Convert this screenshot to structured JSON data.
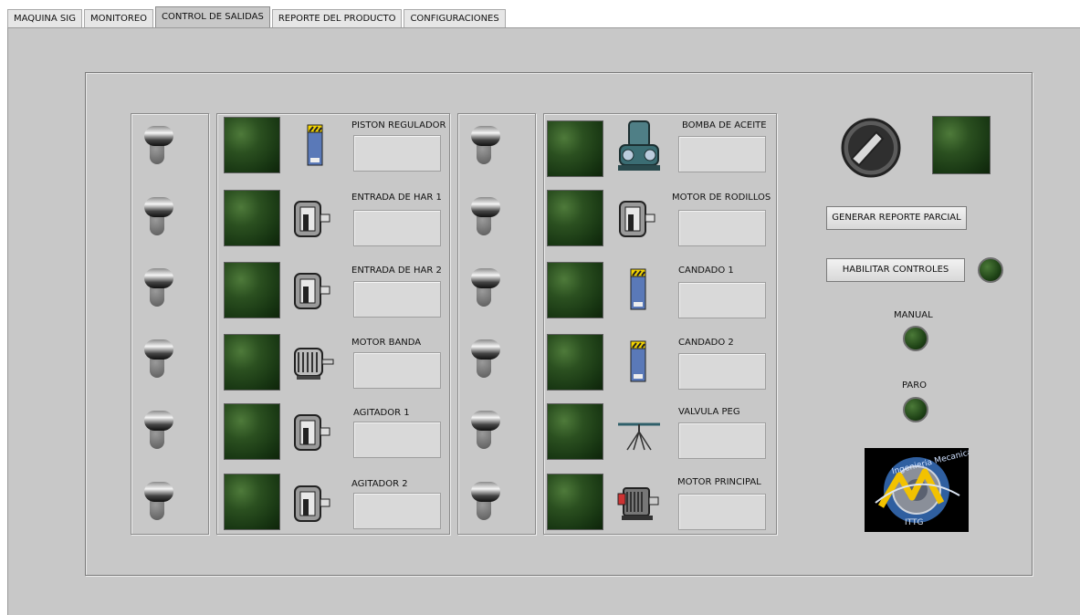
{
  "tabs": [
    {
      "label": "MAQUINA SIG",
      "active": false
    },
    {
      "label": "MONITOREO",
      "active": false
    },
    {
      "label": "CONTROL DE SALIDAS",
      "active": true
    },
    {
      "label": "REPORTE DEL PRODUCTO",
      "active": false
    },
    {
      "label": "CONFIGURACIONES",
      "active": false
    }
  ],
  "left_outputs": [
    {
      "label": "PISTON REGULADOR",
      "icon": "solenoid-valve-icon",
      "value": ""
    },
    {
      "label": "ENTRADA DE HAR 1",
      "icon": "motor-icon",
      "value": ""
    },
    {
      "label": "ENTRADA DE HAR 2",
      "icon": "motor-icon",
      "value": ""
    },
    {
      "label": "MOTOR BANDA",
      "icon": "belt-motor-icon",
      "value": ""
    },
    {
      "label": "AGITADOR 1",
      "icon": "motor-icon",
      "value": ""
    },
    {
      "label": "AGITADOR 2",
      "icon": "motor-icon",
      "value": ""
    }
  ],
  "right_outputs": [
    {
      "label": "BOMBA DE ACEITE",
      "icon": "pump-icon",
      "value": ""
    },
    {
      "label": "MOTOR DE RODILLOS",
      "icon": "motor-icon",
      "value": ""
    },
    {
      "label": "CANDADO 1",
      "icon": "solenoid-valve-icon",
      "value": ""
    },
    {
      "label": "CANDADO 2",
      "icon": "solenoid-valve-icon",
      "value": ""
    },
    {
      "label": "VALVULA PEG",
      "icon": "sprinkler-valve-icon",
      "value": ""
    },
    {
      "label": "MOTOR PRINCIPAL",
      "icon": "main-motor-icon",
      "value": ""
    }
  ],
  "controls": {
    "report_button": "GENERAR REPORTE PARCIAL",
    "enable_button": "HABILITAR CONTROLES",
    "manual_label": "MANUAL",
    "stop_label": "PARO",
    "logo_text_top": "Ingenieria Mecanica",
    "logo_text_bottom": "ITTG"
  },
  "colors": {
    "panel": "#c8c8c8",
    "led_off": "#1f4418",
    "tab_bg": "#e6e6e6"
  }
}
